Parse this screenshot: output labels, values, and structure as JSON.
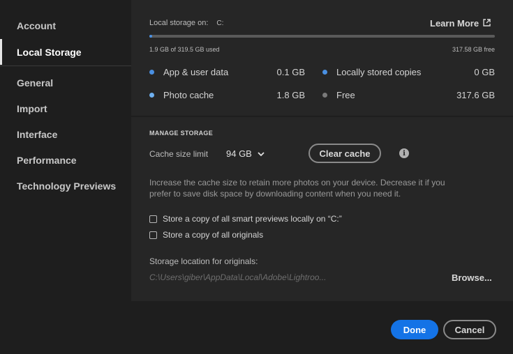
{
  "sidebar": {
    "items": [
      {
        "label": "Account"
      },
      {
        "label": "Local Storage"
      },
      {
        "label": "General"
      },
      {
        "label": "Import"
      },
      {
        "label": "Interface"
      },
      {
        "label": "Performance"
      },
      {
        "label": "Technology Previews"
      }
    ],
    "active_index": 1
  },
  "storage": {
    "label": "Local storage on:",
    "drive": "C:",
    "learn_more": "Learn More",
    "used_text": "1.9 GB of 319.5 GB used",
    "free_text": "317.58 GB free",
    "usage_fraction": 0.006,
    "legend": [
      {
        "label": "App & user data",
        "value": "0.1 GB",
        "color": "#4a90e2"
      },
      {
        "label": "Locally stored copies",
        "value": "0 GB",
        "color": "#4a90e2"
      },
      {
        "label": "Photo cache",
        "value": "1.8 GB",
        "color": "#6fb0f0"
      },
      {
        "label": "Free",
        "value": "317.6 GB",
        "color": "#7a7a7a"
      }
    ]
  },
  "manage": {
    "title": "MANAGE STORAGE",
    "cache_label": "Cache size limit",
    "cache_value": "94 GB",
    "clear_cache": "Clear cache",
    "description": "Increase the cache size to retain more photos on your device. Decrease it if you prefer to save disk space by downloading content when you need it.",
    "checkbox_previews": "Store a copy of all smart previews locally on “C:”",
    "checkbox_originals": "Store a copy of all originals",
    "location_label": "Storage location for originals:",
    "location_path": "C:\\Users\\giber\\AppData\\Local\\Adobe\\Lightroo...",
    "browse": "Browse..."
  },
  "footer": {
    "done": "Done",
    "cancel": "Cancel"
  },
  "colors": {
    "accent": "#1473e6",
    "panel": "#262626",
    "background": "#1e1e1e"
  }
}
